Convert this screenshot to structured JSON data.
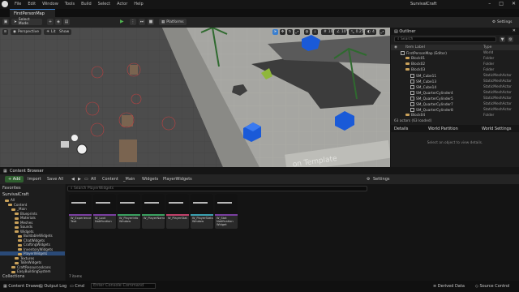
{
  "app": {
    "project_title": "SurvivalCraft",
    "menu": [
      "File",
      "Edit",
      "Window",
      "Tools",
      "Build",
      "Select",
      "Actor",
      "Help"
    ],
    "map_tab": "FirstPersonMap",
    "window_controls": [
      "–",
      "□",
      "✕"
    ]
  },
  "toolbar": {
    "select_mode": "Select Mode",
    "platforms": "Platforms",
    "settings": "Settings"
  },
  "viewport": {
    "perspective": "Perspective",
    "lit": "Lit",
    "show": "Show",
    "grid_size": "10",
    "angle": "10°",
    "scale": "0.25",
    "cam_speed": "4",
    "floor_text": "on Template"
  },
  "outliner": {
    "title": "Outliner",
    "search_placeholder": "Search",
    "col_label": "Item Label",
    "col_type": "Type",
    "rows": [
      {
        "label": "FirstPersonMap (Editor)",
        "type": "World",
        "indent": 0,
        "kind": "world"
      },
      {
        "label": "Block01",
        "type": "Folder",
        "indent": 1,
        "kind": "folder"
      },
      {
        "label": "Block02",
        "type": "Folder",
        "indent": 1,
        "kind": "folder"
      },
      {
        "label": "Block03",
        "type": "Folder",
        "indent": 1,
        "kind": "folder"
      },
      {
        "label": "SM_Cube11",
        "type": "StaticMeshActor",
        "indent": 2,
        "kind": "mesh"
      },
      {
        "label": "SM_Cube13",
        "type": "StaticMeshActor",
        "indent": 2,
        "kind": "mesh"
      },
      {
        "label": "SM_Cube14",
        "type": "StaticMeshActor",
        "indent": 2,
        "kind": "mesh"
      },
      {
        "label": "SM_QuarterCylinder4",
        "type": "StaticMeshActor",
        "indent": 2,
        "kind": "mesh"
      },
      {
        "label": "SM_QuarterCylinder5",
        "type": "StaticMeshActor",
        "indent": 2,
        "kind": "mesh"
      },
      {
        "label": "SM_QuarterCylinder7",
        "type": "StaticMeshActor",
        "indent": 2,
        "kind": "mesh"
      },
      {
        "label": "SM_QuarterCylinder8",
        "type": "StaticMeshActor",
        "indent": 2,
        "kind": "mesh"
      },
      {
        "label": "Block04",
        "type": "Folder",
        "indent": 1,
        "kind": "folder"
      }
    ],
    "footer": "63 actors (63 loaded)"
  },
  "details": {
    "tab_details": "Details",
    "tab_world_partition": "World Partition",
    "tab_world_settings": "World Settings",
    "empty_message": "Select an object to view details."
  },
  "content_browser": {
    "title": "Content Browser",
    "add": "+ Add",
    "import": "Import",
    "save_all": "Save All",
    "breadcrumb": [
      "All",
      "Content",
      "_Main",
      "Widgets",
      "PlayerWidgets"
    ],
    "settings": "Settings",
    "favorites": "Favorites",
    "project": "SurvivalCraft",
    "search_placeholder": "Search PlayerWidgets",
    "tree": [
      {
        "label": "All",
        "indent": 0
      },
      {
        "label": "Content",
        "indent": 1
      },
      {
        "label": "_Main",
        "indent": 2
      },
      {
        "label": "Blueprints",
        "indent": 3
      },
      {
        "label": "Materials",
        "indent": 3
      },
      {
        "label": "Meshes",
        "indent": 3
      },
      {
        "label": "Sounds",
        "indent": 3
      },
      {
        "label": "Widgets",
        "indent": 3
      },
      {
        "label": "BuildableWidgets",
        "indent": 4
      },
      {
        "label": "ChatWidgets",
        "indent": 4
      },
      {
        "label": "CraftingWidgets",
        "indent": 4
      },
      {
        "label": "InventoryWidgets",
        "indent": 4
      },
      {
        "label": "PlayerWidgets",
        "indent": 4,
        "selected": true
      },
      {
        "label": "Textures",
        "indent": 3
      },
      {
        "label": "ToBeWidgets",
        "indent": 3
      },
      {
        "label": "CraftResourcesIcons",
        "indent": 2
      },
      {
        "label": "EasyBuildingSystem",
        "indent": 2
      }
    ],
    "assets": [
      "W_Experience Text",
      "W_Loot Notification",
      "W_PlayerInfo Window",
      "W_PlayerName",
      "W_PlayerStat",
      "W_PlayerStats Window",
      "W_Stat Notification Widget"
    ],
    "item_count": "7 items",
    "collections": "Collections"
  },
  "statusbar": {
    "content_drawer": "Content Drawer",
    "output_log": "Output Log",
    "cmd": "Cmd",
    "console_placeholder": "Enter Console Command",
    "derived_data": "Derived Data",
    "source_control": "Source Control"
  },
  "colors": {
    "accent": "#1a4a80",
    "play": "#4fb24f",
    "folder": "#c9a15a",
    "add_button": "#2f5f2f",
    "cube_blue": "#1a5ad8"
  }
}
